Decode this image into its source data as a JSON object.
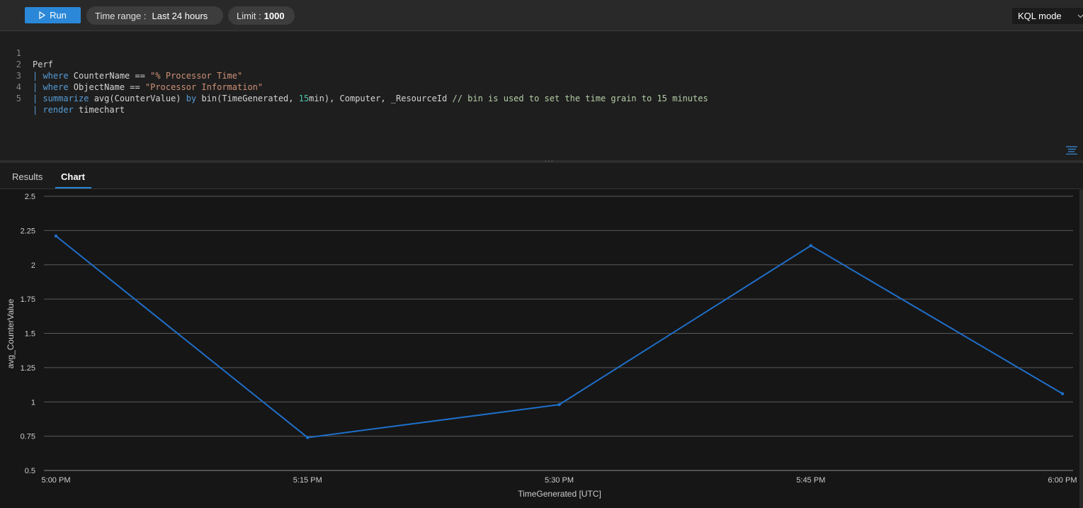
{
  "toolbar": {
    "run_label": "Run",
    "time_range_key": "Time range :",
    "time_range_value": "Last 24 hours",
    "limit_key": "Limit :",
    "limit_value": "1000",
    "mode_label": "KQL mode"
  },
  "editor": {
    "lines": [
      {
        "n": "1",
        "segments": [
          {
            "t": "Perf",
            "c": "plain"
          }
        ]
      },
      {
        "n": "2",
        "segments": [
          {
            "t": "| ",
            "c": "pipe"
          },
          {
            "t": "where",
            "c": "kw"
          },
          {
            "t": " CounterName == ",
            "c": "plain"
          },
          {
            "t": "\"% Processor Time\"",
            "c": "str"
          }
        ]
      },
      {
        "n": "3",
        "segments": [
          {
            "t": "| ",
            "c": "pipe"
          },
          {
            "t": "where",
            "c": "kw"
          },
          {
            "t": " ObjectName == ",
            "c": "plain"
          },
          {
            "t": "\"Processor Information\"",
            "c": "str"
          }
        ]
      },
      {
        "n": "4",
        "segments": [
          {
            "t": "| ",
            "c": "pipe"
          },
          {
            "t": "summarize",
            "c": "kw"
          },
          {
            "t": " avg(CounterValue) ",
            "c": "plain"
          },
          {
            "t": "by",
            "c": "kw"
          },
          {
            "t": " bin(TimeGenerated, ",
            "c": "plain"
          },
          {
            "t": "15",
            "c": "num"
          },
          {
            "t": "min), Computer, _ResourceId ",
            "c": "plain"
          },
          {
            "t": "// bin is used to set the time grain to 15 minutes",
            "c": "cmt"
          }
        ]
      },
      {
        "n": "5",
        "segments": [
          {
            "t": "| ",
            "c": "pipe"
          },
          {
            "t": "render",
            "c": "kw"
          },
          {
            "t": " timechart",
            "c": "plain"
          }
        ]
      }
    ]
  },
  "tabs": {
    "results": "Results",
    "chart": "Chart"
  },
  "colors": {
    "accent": "#2b88d8",
    "series_line": "#1f6fc9"
  },
  "chart_data": {
    "type": "line",
    "xlabel": "TimeGenerated [UTC]",
    "ylabel": "avg_CounterValue",
    "categories": [
      "5:00 PM",
      "5:15 PM",
      "5:30 PM",
      "5:45 PM",
      "6:00 PM"
    ],
    "y_ticks": [
      "2.5",
      "2.25",
      "2",
      "1.75",
      "1.5",
      "1.25",
      "1",
      "0.75",
      "0.5"
    ],
    "ylim": [
      0.5,
      2.5
    ],
    "grid": true,
    "series": [
      {
        "values": [
          2.21,
          0.74,
          0.98,
          2.14,
          1.06
        ]
      }
    ]
  }
}
